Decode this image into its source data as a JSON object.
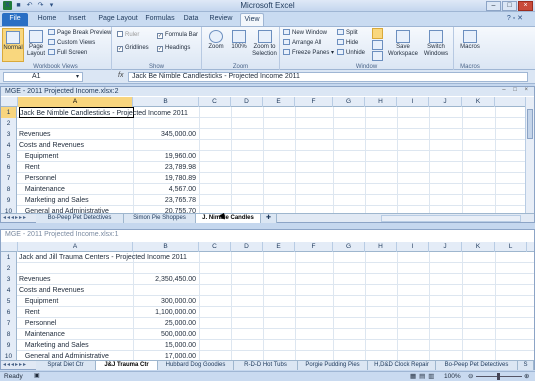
{
  "app": {
    "title": "Microsoft Excel",
    "file_tab": "File"
  },
  "ribbon_tabs": [
    "Home",
    "Insert",
    "Page Layout",
    "Formulas",
    "Data",
    "Review",
    "View"
  ],
  "active_tab": "View",
  "ribbon": {
    "workbook_views": {
      "label": "Workbook Views",
      "normal": "Normal",
      "page_layout": "Page Layout",
      "page_break": "Page Break Preview",
      "custom_views": "Custom Views",
      "full_screen": "Full Screen"
    },
    "show": {
      "label": "Show",
      "ruler": "Ruler",
      "formula_bar": "Formula Bar",
      "gridlines": "Gridlines",
      "headings": "Headings"
    },
    "zoom": {
      "label": "Zoom",
      "zoom": "Zoom",
      "hundred": "100%",
      "to_selection": "Zoom to Selection"
    },
    "window": {
      "label": "Window",
      "new_window": "New Window",
      "arrange_all": "Arrange All",
      "freeze_panes": "Freeze Panes",
      "split": "Split",
      "hide": "Hide",
      "unhide": "Unhide",
      "save_workspace": "Save Workspace",
      "switch_windows": "Switch Windows"
    },
    "macros": {
      "label": "Macros",
      "macros": "Macros"
    }
  },
  "formula_bar": {
    "name_box": "A1",
    "fx": "fx",
    "formula": "Jack Be Nimble Candlesticks - Projected Income 2011"
  },
  "window1": {
    "title": "MGE - 2011 Projected Income.xlsx:2",
    "columns": [
      "A",
      "B",
      "C",
      "D",
      "E",
      "F",
      "G",
      "H",
      "I",
      "J",
      "K"
    ],
    "rows": [
      {
        "n": "1",
        "a": "Jack Be Nimble Candlesticks - Projected Income 2011",
        "b": ""
      },
      {
        "n": "2",
        "a": "",
        "b": ""
      },
      {
        "n": "3",
        "a": "Revenues",
        "b": "345,000.00"
      },
      {
        "n": "4",
        "a": "Costs and Revenues",
        "b": ""
      },
      {
        "n": "5",
        "a": "   Equipment",
        "b": "19,960.00"
      },
      {
        "n": "6",
        "a": "   Rent",
        "b": "23,789.98"
      },
      {
        "n": "7",
        "a": "   Personnel",
        "b": "19,780.89"
      },
      {
        "n": "8",
        "a": "   Maintenance",
        "b": "4,567.00"
      },
      {
        "n": "9",
        "a": "   Marketing and Sales",
        "b": "23,765.78"
      },
      {
        "n": "10",
        "a": "   General and Administrative",
        "b": "20,755.70"
      }
    ],
    "sheets": [
      "Bo-Peep Pet Detectives",
      "Simon Pie Shoppes",
      "J. Nimble Candles"
    ],
    "active_sheet": "J. Nimble Candles"
  },
  "window2": {
    "title": "MGE - 2011 Projected Income.xlsx:1",
    "columns": [
      "A",
      "B",
      "C",
      "D",
      "E",
      "F",
      "G",
      "H",
      "I",
      "J",
      "K",
      "L"
    ],
    "rows": [
      {
        "n": "1",
        "a": "Jack and Jill Trauma Centers - Projected Income 2011",
        "b": ""
      },
      {
        "n": "2",
        "a": "",
        "b": ""
      },
      {
        "n": "3",
        "a": "Revenues",
        "b": "2,350,450.00"
      },
      {
        "n": "4",
        "a": "Costs and Revenues",
        "b": ""
      },
      {
        "n": "5",
        "a": "   Equipment",
        "b": "300,000.00"
      },
      {
        "n": "6",
        "a": "   Rent",
        "b": "1,100,000.00"
      },
      {
        "n": "7",
        "a": "   Personnel",
        "b": "25,000.00"
      },
      {
        "n": "8",
        "a": "   Maintenance",
        "b": "500,000.00"
      },
      {
        "n": "9",
        "a": "   Marketing and Sales",
        "b": "15,000.00"
      },
      {
        "n": "10",
        "a": "   General and Administrative",
        "b": "17,000.00"
      }
    ],
    "sheets": [
      "Sprat Diet Ctr",
      "J&J Trauma Ctr",
      "Hubbard Dog Goodies",
      "R-D-D Hot Tubs",
      "Porgie Pudding Pies",
      "H,D&D Clock Repair",
      "Bo-Peep Pet Detectives",
      "S"
    ],
    "active_sheet": "J&J Trauma Ctr"
  },
  "status": {
    "ready": "Ready",
    "zoom": "100%"
  }
}
